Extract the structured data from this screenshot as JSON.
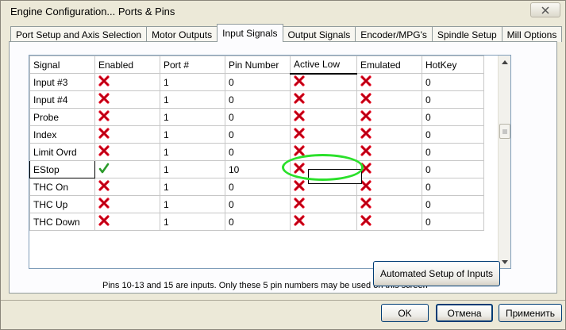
{
  "window": {
    "title": "Engine Configuration... Ports & Pins"
  },
  "tabs": [
    {
      "label": "Port Setup and Axis Selection",
      "active": false
    },
    {
      "label": "Motor Outputs",
      "active": false
    },
    {
      "label": "Input Signals",
      "active": true
    },
    {
      "label": "Output Signals",
      "active": false
    },
    {
      "label": "Encoder/MPG's",
      "active": false
    },
    {
      "label": "Spindle Setup",
      "active": false
    },
    {
      "label": "Mill Options",
      "active": false
    }
  ],
  "grid": {
    "columns": [
      "Signal",
      "Enabled",
      "Port #",
      "Pin Number",
      "Active Low",
      "Emulated",
      "HotKey"
    ],
    "rows": [
      {
        "signal": "Input #3",
        "enabled": "x-mark",
        "port": "1",
        "pin": "0",
        "active_low": "x-mark",
        "emulated": "x-mark",
        "hotkey": "0"
      },
      {
        "signal": "Input #4",
        "enabled": "x-mark",
        "port": "1",
        "pin": "0",
        "active_low": "x-mark",
        "emulated": "x-mark",
        "hotkey": "0"
      },
      {
        "signal": "Probe",
        "enabled": "x-mark",
        "port": "1",
        "pin": "0",
        "active_low": "x-mark",
        "emulated": "x-mark",
        "hotkey": "0"
      },
      {
        "signal": "Index",
        "enabled": "x-mark",
        "port": "1",
        "pin": "0",
        "active_low": "x-mark",
        "emulated": "x-mark",
        "hotkey": "0"
      },
      {
        "signal": "Limit Ovrd",
        "enabled": "x-mark",
        "port": "1",
        "pin": "0",
        "active_low": "x-mark",
        "emulated": "x-mark",
        "hotkey": "0"
      },
      {
        "signal": "EStop",
        "enabled": "check-mark",
        "port": "1",
        "pin": "10",
        "active_low": "x-mark",
        "emulated": "x-mark",
        "hotkey": "0"
      },
      {
        "signal": "THC On",
        "enabled": "x-mark",
        "port": "1",
        "pin": "0",
        "active_low": "x-mark",
        "emulated": "x-mark",
        "hotkey": "0"
      },
      {
        "signal": "THC Up",
        "enabled": "x-mark",
        "port": "1",
        "pin": "0",
        "active_low": "x-mark",
        "emulated": "x-mark",
        "hotkey": "0"
      },
      {
        "signal": "THC Down",
        "enabled": "x-mark",
        "port": "1",
        "pin": "0",
        "active_low": "x-mark",
        "emulated": "x-mark",
        "hotkey": "0"
      }
    ]
  },
  "note": "Pins 10-13 and 15 are inputs. Only these 5 pin numbers may be used on this screen",
  "buttons": {
    "automated": "Automated Setup of Inputs",
    "ok": "OK",
    "cancel": "Отмена",
    "apply": "Применить"
  },
  "colors": {
    "x_mark": "#e0001a",
    "check_mark": "#2a9a2a",
    "highlight": "#2be02b"
  }
}
